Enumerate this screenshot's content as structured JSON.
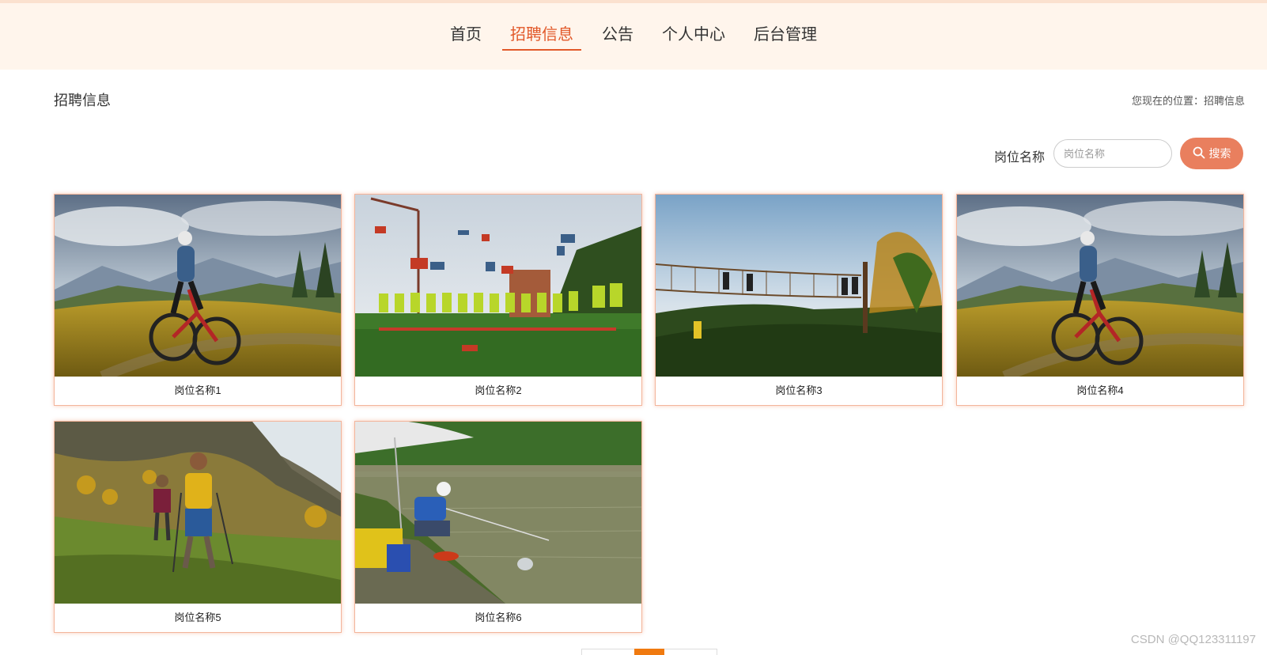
{
  "nav": {
    "items": [
      {
        "label": "首页",
        "active": false
      },
      {
        "label": "招聘信息",
        "active": true
      },
      {
        "label": "公告",
        "active": false
      },
      {
        "label": "个人中心",
        "active": false
      },
      {
        "label": "后台管理",
        "active": false
      }
    ]
  },
  "page": {
    "title": "招聘信息",
    "breadcrumb": "您现在的位置：招聘信息"
  },
  "search": {
    "label": "岗位名称",
    "placeholder": "岗位名称",
    "value": "",
    "button_label": "搜索"
  },
  "cards": [
    {
      "title": "岗位名称1",
      "image": "mountain-biker-photo"
    },
    {
      "title": "岗位名称2",
      "image": "team-building-group-photo"
    },
    {
      "title": "岗位名称3",
      "image": "rope-course-photo"
    },
    {
      "title": "岗位名称4",
      "image": "mountain-biker-photo"
    },
    {
      "title": "岗位名称5",
      "image": "hikers-photo"
    },
    {
      "title": "岗位名称6",
      "image": "fishing-pond-photo"
    }
  ],
  "colors": {
    "accent": "#e2592a",
    "header_bg": "#fff5ec",
    "search_button": "#e97f5e",
    "card_border": "#f3b59b",
    "pager_active": "#f07a10"
  },
  "watermark": "CSDN @QQ123311197"
}
